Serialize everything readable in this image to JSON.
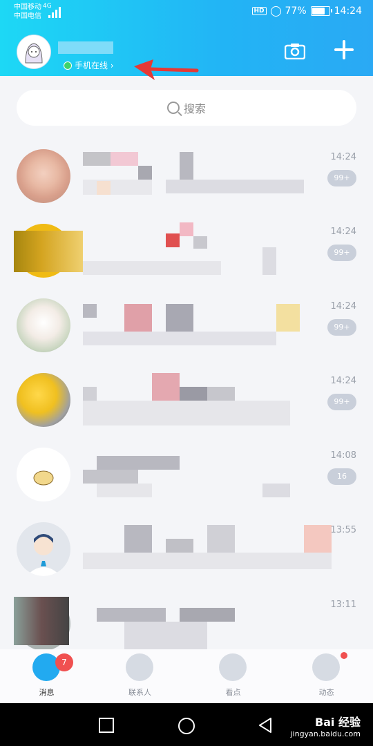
{
  "status": {
    "carrier1": "中国移动",
    "carrier2": "中国电信",
    "net": "4G",
    "battery": "77%",
    "time": "14:24"
  },
  "header": {
    "online_label": "手机在线 ›"
  },
  "search": {
    "placeholder": "搜索"
  },
  "conversations": [
    {
      "time": "14:24",
      "badge": "99+"
    },
    {
      "time": "14:24",
      "badge": "99+"
    },
    {
      "time": "14:24",
      "badge": "99+"
    },
    {
      "time": "14:24",
      "badge": "99+"
    },
    {
      "time": "14:08",
      "badge": "16"
    },
    {
      "time": "13:55",
      "badge": ""
    },
    {
      "time": "13:11",
      "badge": ""
    }
  ],
  "tabs": [
    {
      "label": "消息",
      "badge": "7"
    },
    {
      "label": "联系人"
    },
    {
      "label": "看点"
    },
    {
      "label": "动态"
    }
  ],
  "watermark": {
    "line1": "Bai 经验",
    "line2": "jingyan.baidu.com"
  },
  "colors": {
    "header_start": "#1dd8f5",
    "header_end": "#2aa9f4",
    "badge_red": "#f05050",
    "annotation_arrow": "#e53935"
  }
}
